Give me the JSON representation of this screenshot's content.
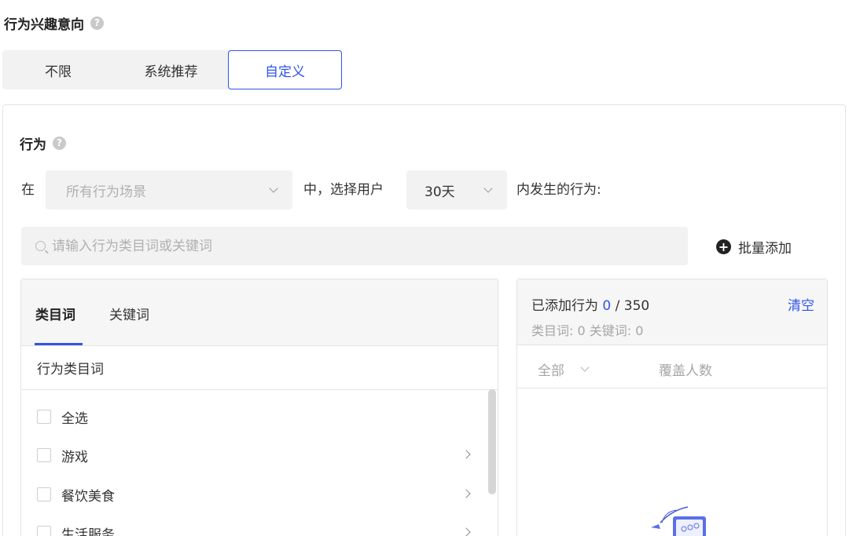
{
  "section": {
    "title": "行为兴趣意向",
    "help_icon": "?"
  },
  "mode_tabs": [
    {
      "label": "不限",
      "selected": false
    },
    {
      "label": "系统推荐",
      "selected": false
    },
    {
      "label": "自定义",
      "selected": true
    }
  ],
  "behavior": {
    "title": "行为",
    "help_icon": "?",
    "sentence": {
      "prefix": "在",
      "scene_select": "所有行为场景",
      "middle": "中，选择用户",
      "days_select": "30天",
      "suffix": "内发生的行为:"
    },
    "search_placeholder": "请输入行为类目词或关键词",
    "bulk_add_label": "批量添加",
    "plus_icon": "+"
  },
  "left_panel": {
    "tabs": [
      {
        "label": "类目词",
        "active": true
      },
      {
        "label": "关键词",
        "active": false
      }
    ],
    "column_header": "行为类目词",
    "rows": [
      {
        "label": "全选",
        "has_children": false
      },
      {
        "label": "游戏",
        "has_children": true
      },
      {
        "label": "餐饮美食",
        "has_children": true
      },
      {
        "label": "生活服务",
        "has_children": true
      }
    ]
  },
  "right_panel": {
    "added_label": "已添加行为",
    "added_count": "0",
    "added_sep": "/",
    "added_max": "350",
    "clear_label": "清空",
    "counts_text": "类目词: 0   关键词: 0",
    "filter_label": "全部",
    "coverage_label": "覆盖人数"
  },
  "colors": {
    "accent": "#2f54eb",
    "panel_bg": "#f6f6f6",
    "input_bg": "#f2f2f2"
  }
}
